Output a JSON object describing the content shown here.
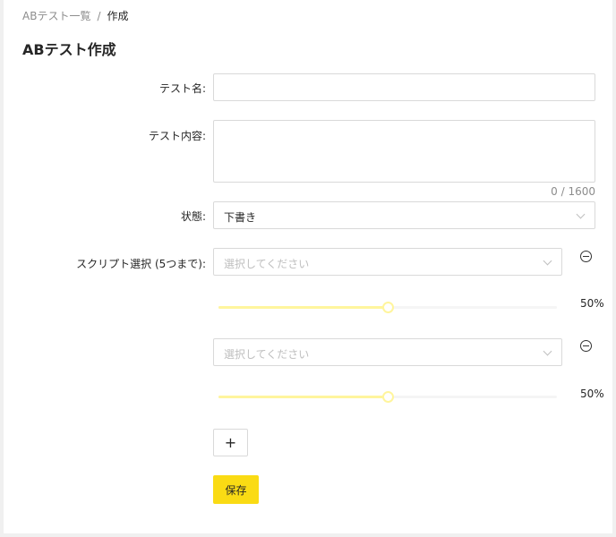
{
  "breadcrumb": {
    "parent": "ABテスト一覧",
    "separator": "/",
    "current": "作成"
  },
  "page": {
    "title": "ABテスト作成"
  },
  "form": {
    "test_name_label": "テスト名:",
    "test_name_value": "",
    "test_content_label": "テスト内容:",
    "test_content_value": "",
    "content_counter": "0 / 1600",
    "status_label": "状態:",
    "status_value": "下書き",
    "script_label": "スクリプト選択 (5つまで):",
    "scripts": [
      {
        "placeholder": "選択してください",
        "percent_text": "50%",
        "weight": 0.5
      },
      {
        "placeholder": "選択してください",
        "percent_text": "50%",
        "weight": 0.5
      }
    ],
    "add_label": "+",
    "save_label": "保存"
  },
  "colors": {
    "accent": "#fadb14",
    "slider_track": "#fff59d",
    "border": "#d9d9d9"
  },
  "icons": {
    "remove": "minus-circle-icon",
    "dropdown": "chevron-down-icon"
  }
}
